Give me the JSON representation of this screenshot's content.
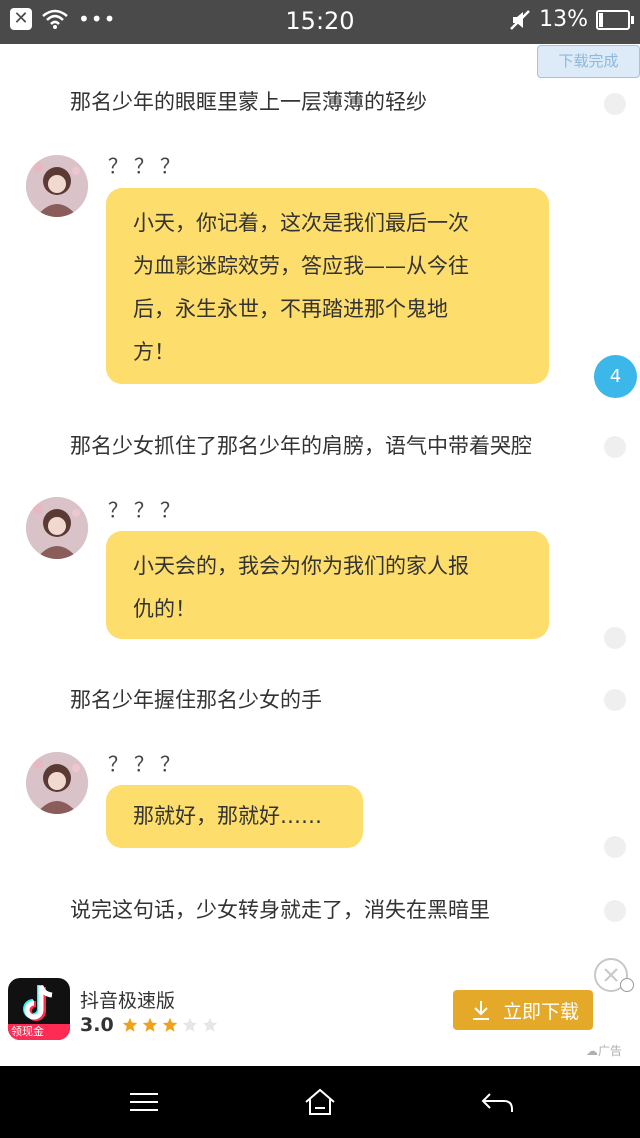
{
  "status_bar": {
    "time": "15:20",
    "battery_text": "13%",
    "battery_level_pct": 13,
    "icons": [
      "close-icon",
      "wifi-icon",
      "more-dots-icon",
      "mute-icon",
      "battery-icon"
    ]
  },
  "download_badge": "下载完成",
  "unread_counter": "4",
  "messages": [
    {
      "type": "narration",
      "text": "那名少年的眼眶里蒙上一层薄薄的轻纱"
    },
    {
      "type": "dialog",
      "speaker": "？？？",
      "lines": [
        "小天，你记着，这次是我们最后一次",
        "为血影迷踪效劳，答应我——从今往",
        "后，永生永世，不再踏进那个鬼地",
        "方！"
      ]
    },
    {
      "type": "narration",
      "text": "那名少女抓住了那名少年的肩膀，语气中带着哭腔"
    },
    {
      "type": "dialog",
      "speaker": "？？？",
      "lines": [
        "小天会的，我会为你为我们的家人报",
        "仇的！"
      ]
    },
    {
      "type": "narration",
      "text": "那名少年握住那名少女的手"
    },
    {
      "type": "dialog",
      "speaker": "？？？",
      "lines": [
        "那就好，那就好……"
      ]
    },
    {
      "type": "narration",
      "text": "说完这句话，少女转身就走了，消失在黑暗里"
    }
  ],
  "ad": {
    "app_name": "抖音极速版",
    "rating": "3.0",
    "stars_filled": 3,
    "stars_total": 5,
    "icon_tag": "领现金",
    "button_label": "立即下载",
    "ad_label": "广告",
    "colors": {
      "button": "#e5a92a",
      "star": "#f0a21b",
      "icon_tag": "#fe2c55"
    }
  },
  "colors": {
    "bubble": "#fddd6c",
    "counter": "#3cb7ea",
    "status_bar": "#4a4a4a"
  },
  "navbar": {
    "icons": [
      "menu-icon",
      "home-icon",
      "back-icon"
    ]
  }
}
